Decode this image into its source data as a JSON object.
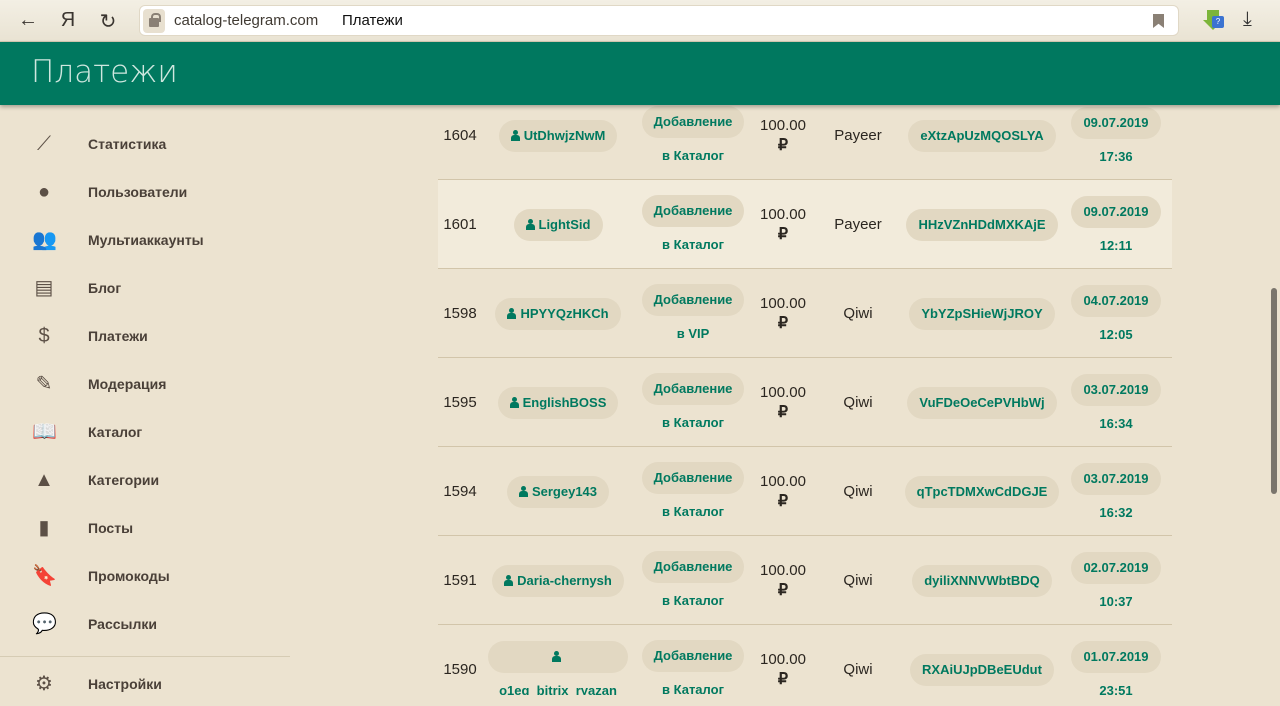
{
  "browser": {
    "url": "catalog-telegram.com",
    "tab_title": "Платежи",
    "back": "←",
    "yandex": "Я",
    "reload": "↻",
    "ext_badge": "?",
    "download": "⤓"
  },
  "header": {
    "title": "Платежи"
  },
  "sidebar": {
    "items": [
      {
        "label": "Статистика",
        "icon": "trending-icon",
        "glyph": "⟋"
      },
      {
        "label": "Пользователи",
        "icon": "account-circle-icon",
        "glyph": "●"
      },
      {
        "label": "Мультиаккаунты",
        "icon": "people-icon",
        "glyph": "👥"
      },
      {
        "label": "Блог",
        "icon": "receipt-icon",
        "glyph": "▤"
      },
      {
        "label": "Платежи",
        "icon": "dollar-icon",
        "glyph": "$"
      },
      {
        "label": "Модерация",
        "icon": "edit-icon",
        "glyph": "✎"
      },
      {
        "label": "Каталог",
        "icon": "book-open-icon",
        "glyph": "📖"
      },
      {
        "label": "Категории",
        "icon": "shapes-icon",
        "glyph": "▲"
      },
      {
        "label": "Посты",
        "icon": "book-icon",
        "glyph": "▮"
      },
      {
        "label": "Промокоды",
        "icon": "bookmark-icon",
        "glyph": "🔖"
      },
      {
        "label": "Рассылки",
        "icon": "message-icon",
        "glyph": "💬"
      },
      {
        "label": "Настройки",
        "icon": "gear-icon",
        "glyph": "⚙"
      }
    ]
  },
  "payments": [
    {
      "id": "1604",
      "user": "UtDhwjzNwM",
      "type1": "Добавление",
      "type2": "в Каталог",
      "amount": "100.00",
      "currency": "₽",
      "method": "Payeer",
      "code": "eXtzApUzMQOSLYA",
      "date": "09.07.2019",
      "time": "17:36"
    },
    {
      "id": "1601",
      "user": "LightSid",
      "type1": "Добавление",
      "type2": "в Каталог",
      "amount": "100.00",
      "currency": "₽",
      "method": "Payeer",
      "code": "HHzVZnHDdMXKAjE",
      "date": "09.07.2019",
      "time": "12:11"
    },
    {
      "id": "1598",
      "user": "HPYYQzHKCh",
      "type1": "Добавление",
      "type2": "в VIP",
      "amount": "100.00",
      "currency": "₽",
      "method": "Qiwi",
      "code": "YbYZpSHieWjJROY",
      "date": "04.07.2019",
      "time": "12:05"
    },
    {
      "id": "1595",
      "user": "EnglishBOSS",
      "type1": "Добавление",
      "type2": "в Каталог",
      "amount": "100.00",
      "currency": "₽",
      "method": "Qiwi",
      "code": "VuFDeOeCePVHbWj",
      "date": "03.07.2019",
      "time": "16:34"
    },
    {
      "id": "1594",
      "user": "Sergey143",
      "type1": "Добавление",
      "type2": "в Каталог",
      "amount": "100.00",
      "currency": "₽",
      "method": "Qiwi",
      "code": "qTpcTDMXwCdDGJE",
      "date": "03.07.2019",
      "time": "16:32"
    },
    {
      "id": "1591",
      "user": "Daria-chernysh",
      "type1": "Добавление",
      "type2": "в Каталог",
      "amount": "100.00",
      "currency": "₽",
      "method": "Qiwi",
      "code": "dyiliXNNVWbtBDQ",
      "date": "02.07.2019",
      "time": "10:37"
    },
    {
      "id": "1590",
      "user": "o1eg_bitrix_ryazan",
      "type1": "Добавление",
      "type2": "в Каталог",
      "amount": "100.00",
      "currency": "₽",
      "method": "Qiwi",
      "code": "RXAiUJpDBeEUdut",
      "date": "01.07.2019",
      "time": "23:51"
    }
  ]
}
